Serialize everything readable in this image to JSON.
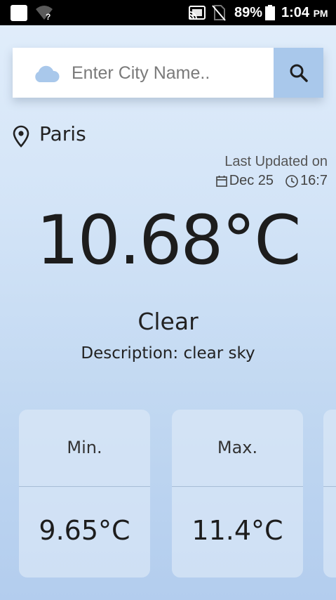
{
  "status_bar": {
    "battery_percent": "89%",
    "time": "1:04",
    "ampm": "PM",
    "icons": [
      "app-notification-icon",
      "wifi-unknown-icon",
      "cast-icon",
      "no-sim-icon",
      "battery-icon"
    ],
    "battery_level": 0.89
  },
  "search": {
    "placeholder": "Enter City Name..",
    "value": "",
    "icon_left": "cloud-icon",
    "button_icon": "search-icon"
  },
  "location": {
    "icon": "location-pin-icon",
    "city": "Paris"
  },
  "updated": {
    "label": "Last Updated on",
    "date": "Dec 25",
    "time": "16:7",
    "date_icon": "calendar-icon",
    "time_icon": "clock-icon"
  },
  "weather": {
    "temperature": "10.68°C",
    "condition": "Clear",
    "description": "Description: clear sky"
  },
  "cards": [
    {
      "label": "Min.",
      "value": "9.65°C"
    },
    {
      "label": "Max.",
      "value": "11.4°C"
    }
  ],
  "colors": {
    "accent": "#a9c8eb",
    "cloud": "#a9c8eb",
    "background_top": "#e2eefb",
    "background_bottom": "#b3cdee"
  }
}
